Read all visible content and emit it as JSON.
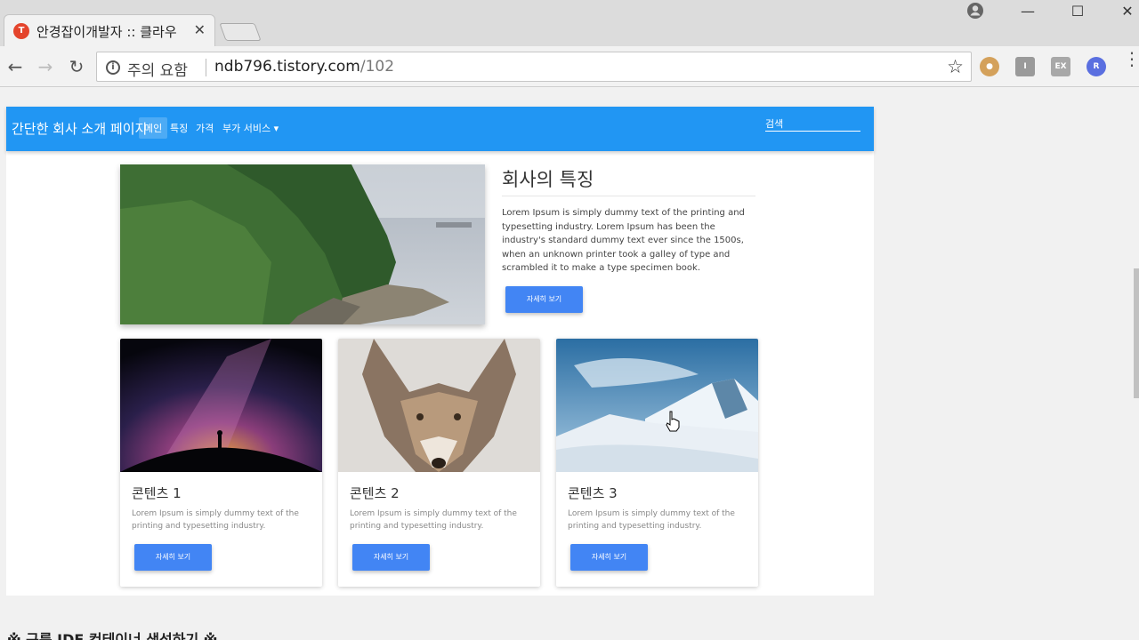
{
  "browser": {
    "tab_title": "안경잡이개발자 :: 클라우",
    "tab_favicon": "tistory-favicon",
    "security_label": "주의 요함",
    "url_host": "ndb796.tistory.com",
    "url_path": "/102",
    "window_controls": [
      "minimize",
      "maximize",
      "close"
    ],
    "extensions": [
      {
        "name": "cookie-extension-icon",
        "label": ""
      },
      {
        "name": "ext-i-icon",
        "label": "I"
      },
      {
        "name": "ext-ex-icon",
        "label": "EX"
      },
      {
        "name": "ext-r-icon",
        "label": "R"
      }
    ]
  },
  "site": {
    "brand": "간단한 회사 소개 페이지",
    "nav": [
      {
        "label": "메인",
        "active": true
      },
      {
        "label": "특징"
      },
      {
        "label": "가격"
      },
      {
        "label": "부가 서비스"
      }
    ],
    "search_placeholder": "검색"
  },
  "feature": {
    "title": "회사의 특징",
    "text": "Lorem Ipsum is simply dummy text of the printing and typesetting industry. Lorem Ipsum has been the industry's standard dummy text ever since the 1500s, when an unknown printer took a galley of type and scrambled it to make a type specimen book.",
    "button": "자세히 보기"
  },
  "cards": [
    {
      "title": "콘텐츠 1",
      "text": "Lorem Ipsum is simply dummy text of the printing and typesetting industry.",
      "button": "자세히 보기"
    },
    {
      "title": "콘텐츠 2",
      "text": "Lorem Ipsum is simply dummy text of the printing and typesetting industry.",
      "button": "자세히 보기"
    },
    {
      "title": "콘텐츠 3",
      "text": "Lorem Ipsum is simply dummy text of the printing and typesetting industry.",
      "button": "자세히 보기"
    }
  ],
  "below_heading": "※ 구름 IDE 컨테이너 생성하기 ※",
  "colors": {
    "navbar": "#2196f3",
    "button": "#4285f4"
  }
}
